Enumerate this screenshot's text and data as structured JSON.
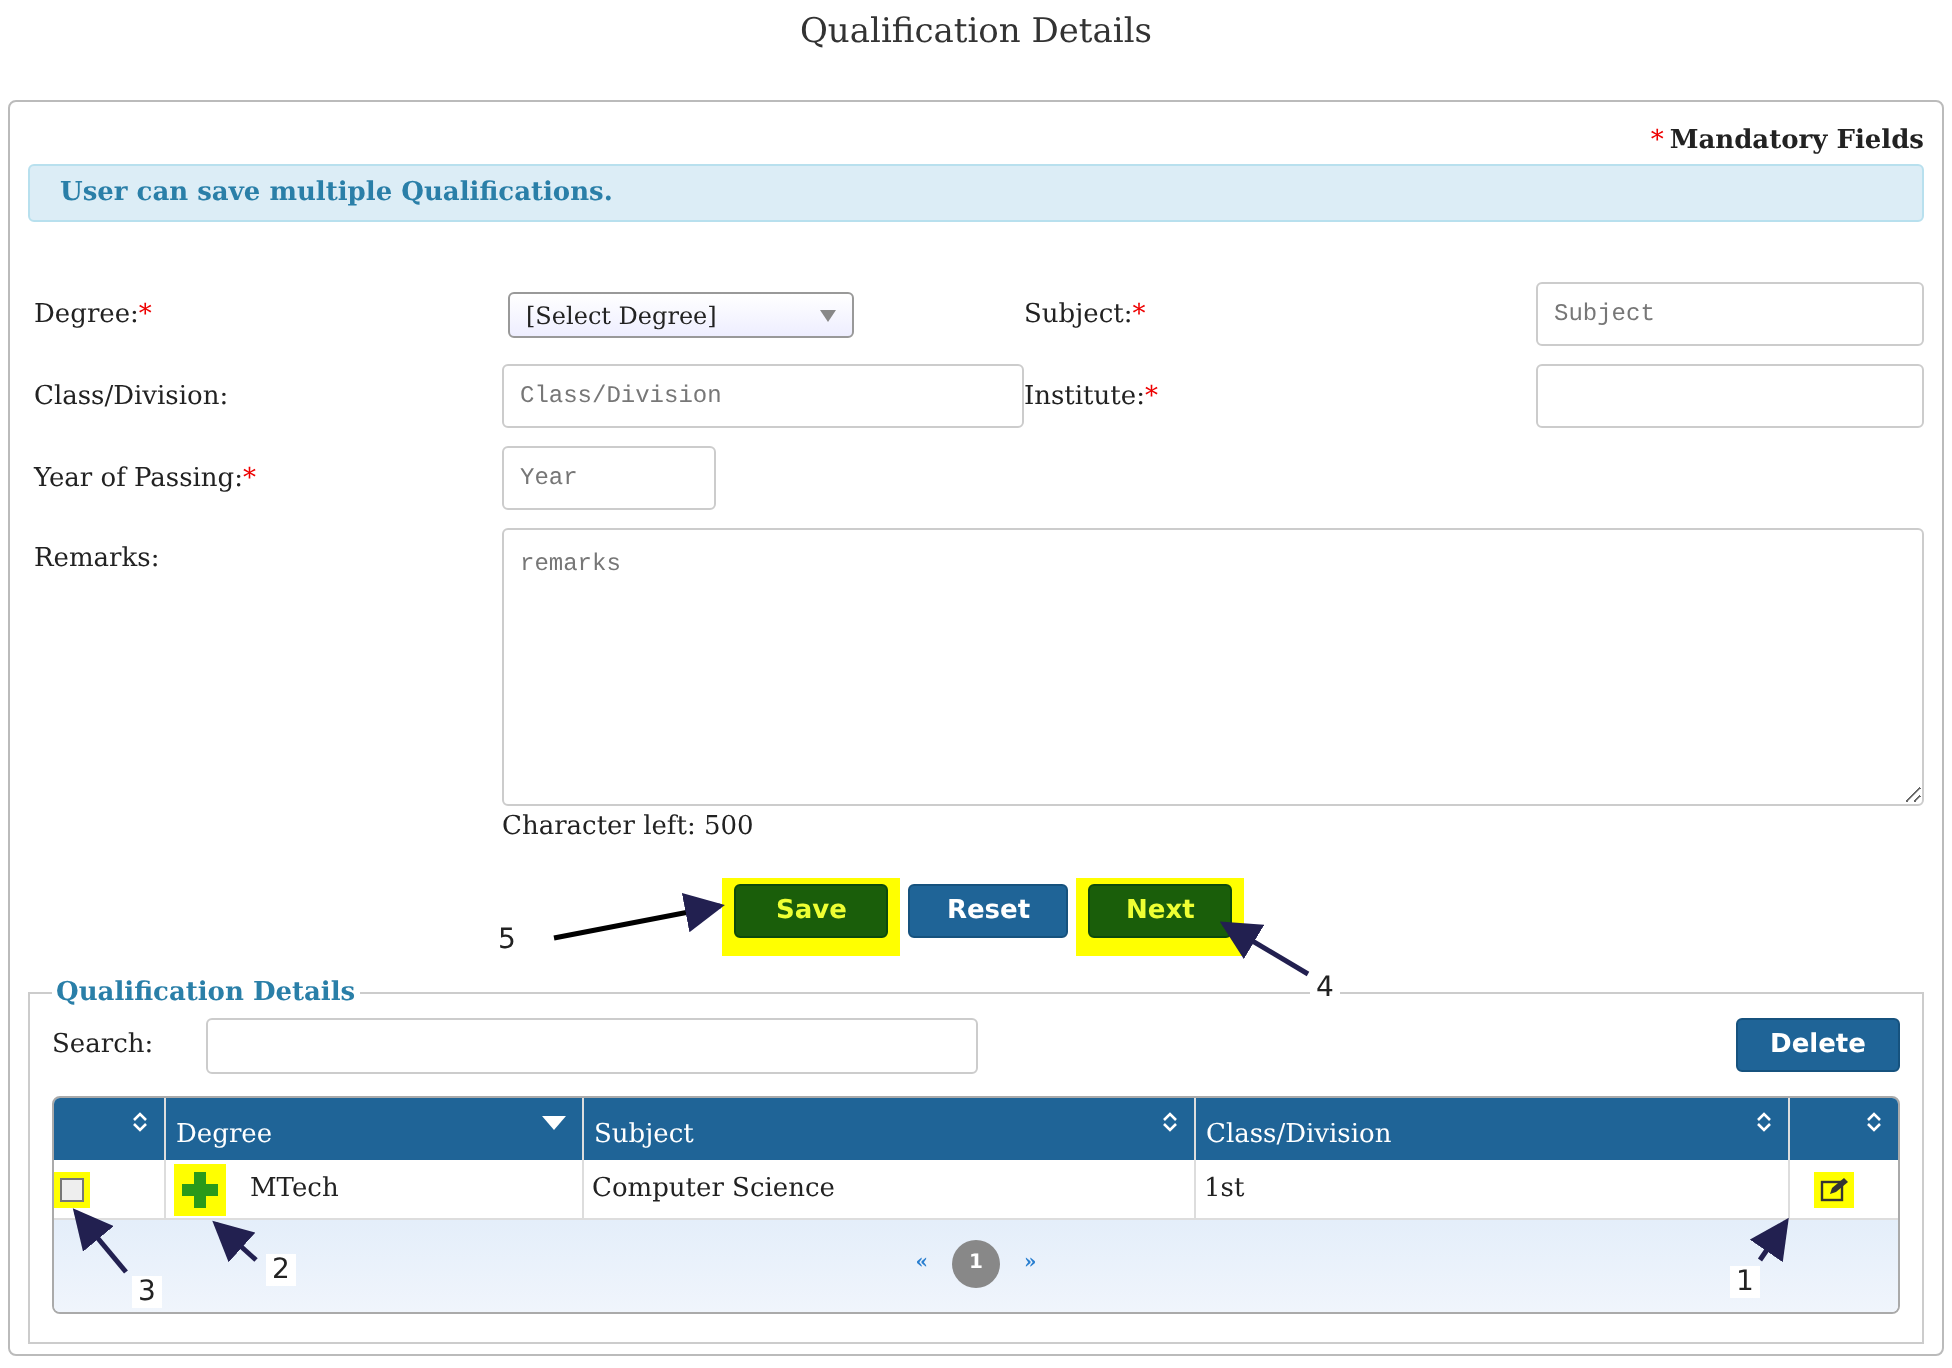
{
  "page_title": "Qualification Details",
  "mandatory_note": {
    "mark": "*",
    "text": "Mandatory Fields"
  },
  "info_message": "User can save multiple Qualifications.",
  "form": {
    "fields": [
      {
        "kind": "select",
        "label": "Degree:",
        "required": true,
        "value": "[Select Degree]"
      },
      {
        "kind": "input",
        "label": "Subject:",
        "required": true,
        "placeholder": "Subject"
      },
      {
        "kind": "input",
        "label": "Class/Division:",
        "required": false,
        "placeholder": "Class/Division"
      },
      {
        "kind": "input",
        "label": "Institute:",
        "required": true
      },
      {
        "kind": "short",
        "label": "Year of Passing:",
        "required": true,
        "placeholder": "Year"
      },
      {
        "kind": "textarea",
        "label": "Remarks:",
        "required": false,
        "placeholder": "remarks"
      }
    ],
    "char_left": "Character left: 500"
  },
  "buttons": [
    {
      "label": "Save",
      "kind": "green",
      "highlighted": true
    },
    {
      "label": "Reset",
      "kind": "blue",
      "highlighted": false
    },
    {
      "label": "Next",
      "kind": "green",
      "highlighted": true
    }
  ],
  "grid": {
    "legend": "Qualification Details",
    "search_label": "Search:",
    "delete_button": "Delete",
    "columns": [
      {
        "sorted": false
      },
      {
        "label": "Degree",
        "sorted": true
      },
      {
        "label": "Subject",
        "sorted": false
      },
      {
        "label": "Class/Division",
        "sorted": false
      },
      {
        "sorted": false
      }
    ],
    "rows": [
      {
        "checked": false,
        "checkbox_highlighted": true,
        "expand_highlighted": true,
        "degree": "MTech",
        "subject": "Computer Science",
        "class_division": "1st",
        "edit_highlighted": true
      }
    ],
    "pager": {
      "prev": "«",
      "pages": [
        {
          "label": "1",
          "selected": true
        }
      ],
      "next": "»"
    }
  },
  "annotations": [
    {
      "label": "5"
    },
    {
      "label": "4"
    },
    {
      "label": "3"
    },
    {
      "label": "2"
    },
    {
      "label": "1"
    }
  ]
}
